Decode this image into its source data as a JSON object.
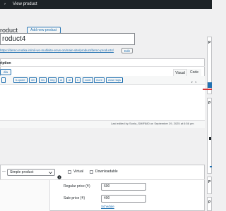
{
  "admin_bar": {
    "view_product": "View product"
  },
  "header": {
    "title_fragment": "roduct",
    "add_new_label": "Add new product"
  },
  "product_title": {
    "value": "roduct4"
  },
  "permalink": {
    "url": "https://demo.mutka.in/mil-wc-multisite-envs-on/main-site/product/demo-product4/",
    "edit_label": "Edit"
  },
  "description": {
    "header_label": "ription",
    "add_media_label": "dia",
    "tab_visual": "Visual",
    "tab_code": "Code",
    "quicktags": [
      "b-quote",
      "del",
      "ins",
      "img",
      "ul",
      "ol",
      "li",
      "code",
      "more",
      "close tags"
    ],
    "last_edited": "Last edited by Sonia_SMIF880 on September 29, 2025 at 6:56 pm"
  },
  "product_data": {
    "separator": "—",
    "type_selected": "Simple product",
    "virtual_label": "Virtual",
    "downloadable_label": "Downloadable",
    "regular_price_label": "Regular price (₹)",
    "regular_price_value": "600",
    "sale_price_label": "Sale price (₹)",
    "sale_price_value": "400",
    "schedule_label": "Schedule"
  },
  "sidebar": {
    "box1_initial": "P",
    "box2_initial": "P",
    "box3_initial": "P",
    "box4_initial": "P"
  },
  "colors": {
    "accent": "#2271b1",
    "danger": "#d63638",
    "admin_bar": "#1d2327"
  },
  "icons": {
    "admin_bar_symbol": "›",
    "fullscreen": "expand-icon",
    "help": "help-icon"
  }
}
